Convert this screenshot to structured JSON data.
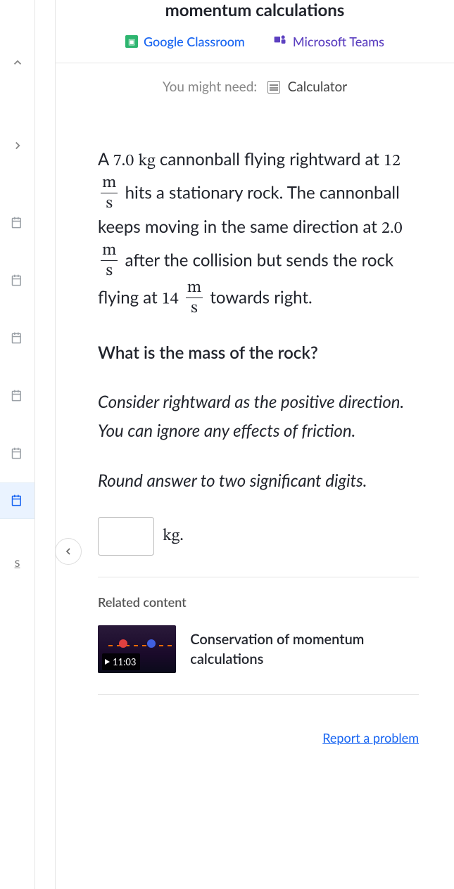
{
  "header": {
    "title": "momentum calculations",
    "share": {
      "google": "Google Classroom",
      "teams": "Microsoft Teams"
    }
  },
  "need": {
    "prefix": "You might need:",
    "tool": "Calculator"
  },
  "problem": {
    "mass1": "7.0",
    "mass_unit": "kg",
    "text1a": "A ",
    "text1b": " cannonball flying rightward at ",
    "v1": "12",
    "text2": " hits a stationary rock. The cannonball keeps moving in the same direction at ",
    "v2": "2.0",
    "text3": " after the collision but sends the rock flying at ",
    "v3": "14",
    "text4": " towards right.",
    "frac_n": "m",
    "frac_d": "s",
    "question": "What is the mass of the rock?",
    "hint": "Consider rightward as the positive direction. You can ignore any effects of friction.",
    "round": "Round answer to two significant digits.",
    "answer_unit": "kg."
  },
  "related": {
    "heading": "Related content",
    "item_title": "Conservation of momentum calculations",
    "duration": "11:03"
  },
  "report": "Report a problem",
  "sidebar": {
    "bottom_label": "s"
  }
}
